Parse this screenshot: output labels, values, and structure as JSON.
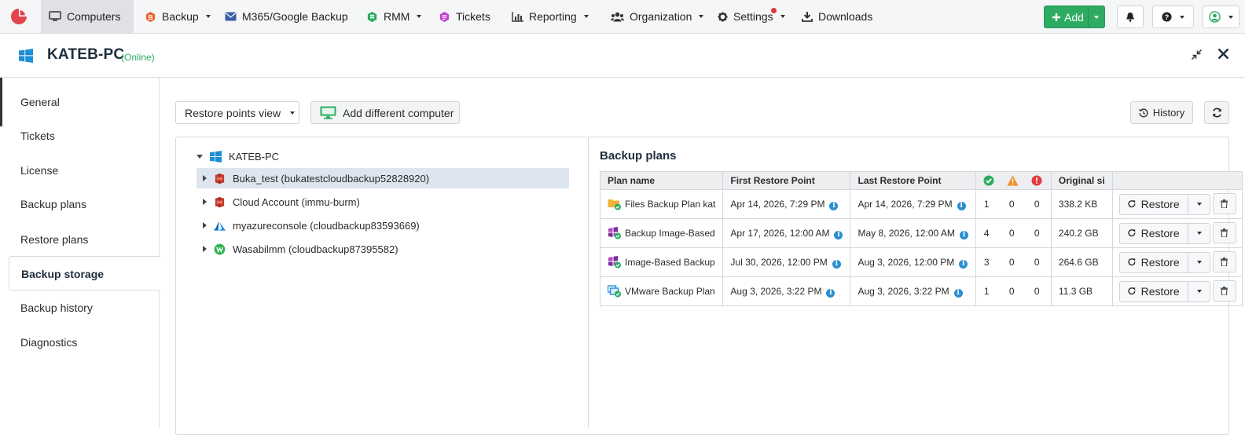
{
  "nav": {
    "items": [
      {
        "label": "Computers",
        "icon": "monitor-icon"
      },
      {
        "label": "Backup",
        "icon": "backup-icon"
      },
      {
        "label": "M365/Google Backup",
        "icon": "envelope-icon"
      },
      {
        "label": "RMM",
        "icon": "rmm-icon"
      },
      {
        "label": "Tickets",
        "icon": "tickets-icon"
      },
      {
        "label": "Reporting",
        "icon": "bar-chart-icon"
      },
      {
        "label": "Organization",
        "icon": "users-icon"
      },
      {
        "label": "Settings",
        "icon": "gear-icon"
      },
      {
        "label": "Downloads",
        "icon": "download-icon"
      }
    ],
    "add_label": "Add"
  },
  "header": {
    "computer_name": "KATEB-PC",
    "status": "(Online)"
  },
  "sidebar": {
    "items": [
      {
        "label": "General"
      },
      {
        "label": "Tickets"
      },
      {
        "label": "License"
      },
      {
        "label": "Backup plans"
      },
      {
        "label": "Restore plans"
      },
      {
        "label": "Backup storage"
      },
      {
        "label": "Backup history"
      },
      {
        "label": "Diagnostics"
      }
    ],
    "active": "Backup storage"
  },
  "toolbar": {
    "view_select": "Restore points view",
    "add_computer": "Add different computer",
    "history": "History"
  },
  "tree": {
    "root": "KATEB-PC",
    "children": [
      {
        "label": "Buka_test (bukatestcloudbackup52828920)",
        "icon": "amazon-s3-icon"
      },
      {
        "label": "Cloud Account (immu-burm)",
        "icon": "amazon-s3-icon"
      },
      {
        "label": "myazureconsole (cloudbackup83593669)",
        "icon": "azure-icon"
      },
      {
        "label": "Wasabilmm (cloudbackup87395582)",
        "icon": "wasabi-icon"
      }
    ]
  },
  "backup_plans": {
    "title": "Backup plans",
    "columns": [
      "Plan name",
      "First Restore Point",
      "Last Restore Point",
      "Original si"
    ],
    "status_icons": [
      "success-icon",
      "warning-icon",
      "error-icon"
    ],
    "restore_label": "Restore",
    "rows": [
      {
        "name": "Files Backup Plan kat",
        "icon": "files-plan-icon",
        "first": "Apr 14, 2026, 7:29 PM",
        "last": "Apr 14, 2026, 7:29 PM",
        "ok": "1",
        "warn": "0",
        "err": "0",
        "size": "338.2 KB"
      },
      {
        "name": "Backup Image-Based",
        "icon": "image-plan-icon",
        "first": "Apr 17, 2026, 12:00 AM",
        "last": "May 8, 2026, 12:00 AM",
        "ok": "4",
        "warn": "0",
        "err": "0",
        "size": "240.2 GB"
      },
      {
        "name": "Image-Based Backup",
        "icon": "image-plan-icon",
        "first": "Jul 30, 2026, 12:00 PM",
        "last": "Aug 3, 2026, 12:00 PM",
        "ok": "3",
        "warn": "0",
        "err": "0",
        "size": "264.6 GB"
      },
      {
        "name": "VMware Backup Plan",
        "icon": "vmware-plan-icon",
        "first": "Aug 3, 2026, 3:22 PM",
        "last": "Aug 3, 2026, 3:22 PM",
        "ok": "1",
        "warn": "0",
        "err": "0",
        "size": "11.3 GB"
      }
    ]
  }
}
